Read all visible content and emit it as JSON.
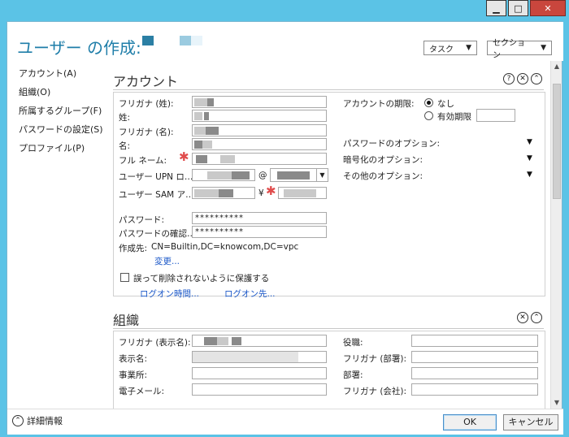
{
  "window": {
    "minimize": "▁",
    "maximize": "□",
    "close": "✕"
  },
  "header": {
    "title": "ユーザー の作成:",
    "task_label": "タスク",
    "section_label": "セクション"
  },
  "sidebar": {
    "items": [
      {
        "label": "アカウント(A)"
      },
      {
        "label": "組織(O)"
      },
      {
        "label": "所属するグループ(F)"
      },
      {
        "label": "パスワードの設定(S)"
      },
      {
        "label": "プロファイル(P)"
      }
    ]
  },
  "account": {
    "title": "アカウント",
    "help": "?",
    "close": "✕",
    "collapse": "⌃",
    "furigana_last": "フリガナ (姓):",
    "last_name": "姓:",
    "furigana_first": "フリガナ (名):",
    "first_name": "名:",
    "full_name": "フル ネーム:",
    "upn_label": "ユーザー UPN ロ…",
    "at": "@",
    "sam_label": "ユーザー SAM ア…",
    "yen": "¥",
    "password_label": "パスワード:",
    "password_value": "**********",
    "confirm_label": "パスワードの確認…",
    "confirm_value": "**********",
    "created_in_label": "作成先:",
    "created_in_value": "CN=Builtin,DC=knowcom,DC=vpc",
    "change_link": "変更...",
    "protect_label": "誤って削除されないように保護する",
    "logon_hours": "ログオン時間...",
    "logon_to": "ログオン先...",
    "expiry_label": "アカウントの期限:",
    "expiry_none": "なし",
    "expiry_date": "有効期限",
    "password_options": "パスワードのオプション:",
    "encryption_options": "暗号化のオプション:",
    "other_options": "その他のオプション:"
  },
  "organization": {
    "title": "組織",
    "close": "✕",
    "collapse": "⌃",
    "furigana_display": "フリガナ (表示名):",
    "display_name": "表示名:",
    "office": "事業所:",
    "email": "電子メール:",
    "job_title": "役職:",
    "furigana_dept": "フリガナ (部署):",
    "department": "部署:",
    "furigana_company": "フリガナ (会社):"
  },
  "footer": {
    "details": "詳細情報",
    "ok": "OK",
    "cancel": "キャンセル"
  },
  "colors": {
    "accent": "#1f7ea9",
    "link": "#1a57c8",
    "required": "#e04c4c",
    "chrome": "#5bc3e6"
  }
}
